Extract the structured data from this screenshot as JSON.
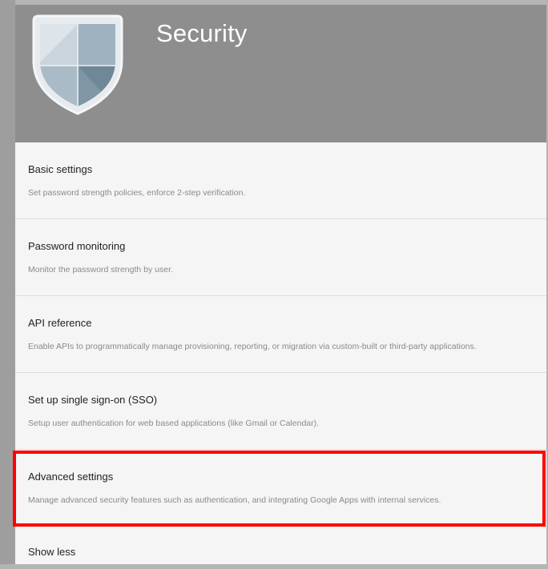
{
  "header": {
    "title": "Security",
    "background_color": "#8e8e8e"
  },
  "items": [
    {
      "title": "Basic settings",
      "description": "Set password strength policies, enforce 2-step verification."
    },
    {
      "title": "Password monitoring",
      "description": "Monitor the password strength by user."
    },
    {
      "title": "API reference",
      "description": "Enable APIs to programmatically manage provisioning, reporting, or migration via custom-built or third-party applications."
    },
    {
      "title": "Set up single sign-on (SSO)",
      "description": "Setup user authentication for web based applications (like Gmail or Calendar)."
    },
    {
      "title": "Advanced settings",
      "description": "Manage advanced security features such as authentication, and integrating Google Apps with internal services.",
      "highlighted": true
    }
  ],
  "show_less_label": "Show less",
  "highlight_color": "#ff0000"
}
